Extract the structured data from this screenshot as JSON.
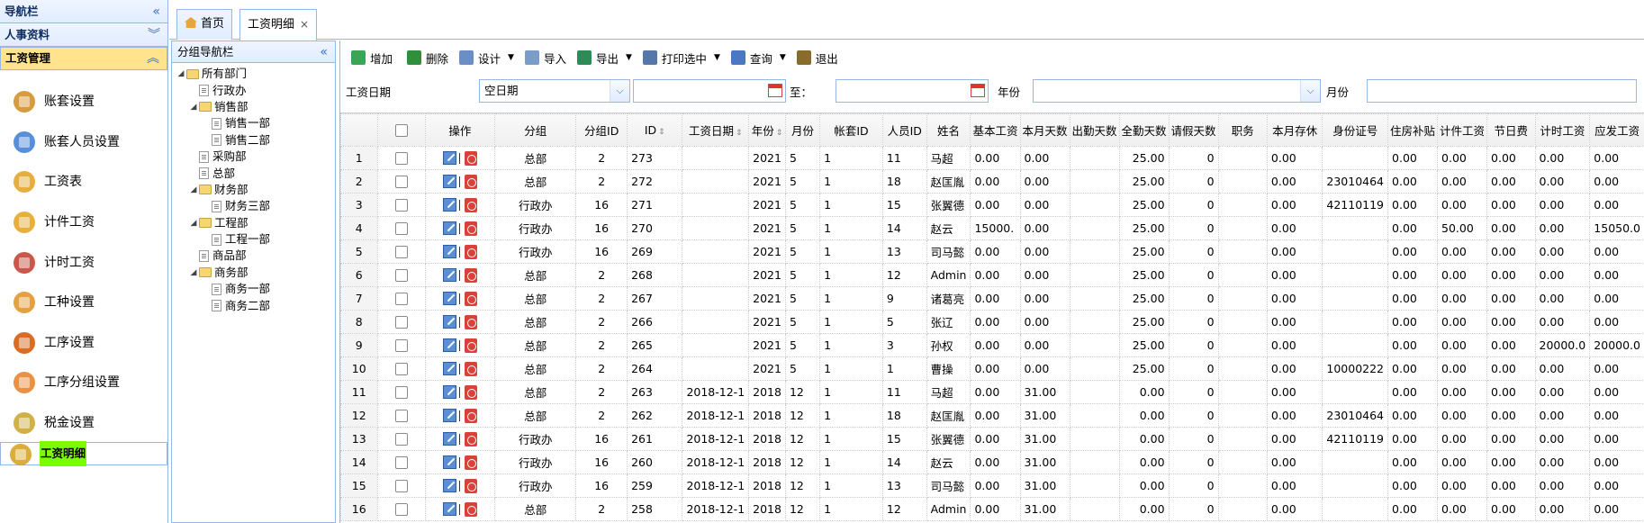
{
  "nav": {
    "sections": [
      {
        "label": "导航栏",
        "chevron": "«"
      },
      {
        "label": "人事资料",
        "chevron": "¥"
      },
      {
        "label": "工资管理",
        "chevron": "¤"
      }
    ],
    "items": [
      {
        "label": "账套设置",
        "icon": "people-settings-icon"
      },
      {
        "label": "账套人员设置",
        "icon": "people-gear-icon"
      },
      {
        "label": "工资表",
        "icon": "bar-chart-icon"
      },
      {
        "label": "计件工资",
        "icon": "coins-icon"
      },
      {
        "label": "计时工资",
        "icon": "clock-chart-icon"
      },
      {
        "label": "工种设置",
        "icon": "worker-icon"
      },
      {
        "label": "工序设置",
        "icon": "process-icon"
      },
      {
        "label": "工序分组设置",
        "icon": "process-group-icon"
      },
      {
        "label": "税金设置",
        "icon": "tax-icon"
      },
      {
        "label": "工资明细",
        "icon": "money-bag-icon"
      }
    ]
  },
  "tabs": [
    {
      "label": "首页",
      "icon": "home-icon"
    },
    {
      "label": "工资明细",
      "close": "×"
    }
  ],
  "group_panel": {
    "title": "分组导航栏",
    "chevron": "«",
    "tree": [
      {
        "label": "所有部门",
        "type": "folder",
        "level": 0
      },
      {
        "label": "行政办",
        "type": "file",
        "level": 1
      },
      {
        "label": "销售部",
        "type": "folder",
        "level": 1
      },
      {
        "label": "销售一部",
        "type": "file",
        "level": 2
      },
      {
        "label": "销售二部",
        "type": "file",
        "level": 2
      },
      {
        "label": "采购部",
        "type": "file",
        "level": 1
      },
      {
        "label": "总部",
        "type": "file",
        "level": 1
      },
      {
        "label": "财务部",
        "type": "folder",
        "level": 1
      },
      {
        "label": "财务三部",
        "type": "file",
        "level": 2
      },
      {
        "label": "工程部",
        "type": "folder",
        "level": 1
      },
      {
        "label": "工程一部",
        "type": "file",
        "level": 2
      },
      {
        "label": "商品部",
        "type": "file",
        "level": 1
      },
      {
        "label": "商务部",
        "type": "folder",
        "level": 1
      },
      {
        "label": "商务一部",
        "type": "file",
        "level": 2
      },
      {
        "label": "商务二部",
        "type": "file",
        "level": 2
      }
    ]
  },
  "toolbar": [
    {
      "label": "增加",
      "icon": "add-icon",
      "color": "#3aa655",
      "dropdown": false
    },
    {
      "label": "删除",
      "icon": "delete-icon",
      "color": "#2f8f3a",
      "dropdown": false
    },
    {
      "label": "设计",
      "icon": "design-icon",
      "color": "#6a8fc7",
      "dropdown": true
    },
    {
      "label": "导入",
      "icon": "import-icon",
      "color": "#7a9cc9",
      "dropdown": false
    },
    {
      "label": "导出",
      "icon": "excel-icon",
      "color": "#2e8b57",
      "dropdown": true
    },
    {
      "label": "打印选中",
      "icon": "print-icon",
      "color": "#5577aa",
      "dropdown": true
    },
    {
      "label": "查询",
      "icon": "search-icon",
      "color": "#4a78c2",
      "dropdown": true
    },
    {
      "label": "退出",
      "icon": "exit-icon",
      "color": "#8a6b2e",
      "dropdown": false
    }
  ],
  "filter": {
    "date_label": "工资日期",
    "date_mode": "空日期",
    "to_label": "至：",
    "year_label": "年份",
    "month_label": "月份"
  },
  "columns": [
    "操作",
    "分组",
    "分组ID",
    "ID",
    "工资日期",
    "年份",
    "月份",
    "帐套ID",
    "人员ID",
    "姓名",
    "基本工资",
    "本月天数",
    "出勤天数",
    "全勤天数",
    "请假天数",
    "职务",
    "本月存休",
    "身份证号",
    "住房补贴",
    "计件工资",
    "节日费",
    "计时工资",
    "应发工资"
  ],
  "rows": [
    [
      "1",
      "总部",
      "2",
      "273",
      "",
      "2021",
      "5",
      "1",
      "11",
      "马超",
      "0.00",
      "0.00",
      "",
      "25.00",
      "0",
      "",
      "0.00",
      "",
      "0.00",
      "0.00",
      "0.00",
      "0.00",
      "0.00"
    ],
    [
      "2",
      "总部",
      "2",
      "272",
      "",
      "2021",
      "5",
      "1",
      "18",
      "赵匡胤",
      "0.00",
      "0.00",
      "",
      "25.00",
      "0",
      "",
      "0.00",
      "23010464",
      "0.00",
      "0.00",
      "0.00",
      "0.00",
      "0.00"
    ],
    [
      "3",
      "行政办",
      "16",
      "271",
      "",
      "2021",
      "5",
      "1",
      "15",
      "张翼德",
      "0.00",
      "0.00",
      "",
      "25.00",
      "0",
      "",
      "0.00",
      "42110119",
      "0.00",
      "0.00",
      "0.00",
      "0.00",
      "0.00"
    ],
    [
      "4",
      "行政办",
      "16",
      "270",
      "",
      "2021",
      "5",
      "1",
      "14",
      "赵云",
      "15000.",
      "0.00",
      "",
      "25.00",
      "0",
      "",
      "0.00",
      "",
      "0.00",
      "50.00",
      "0.00",
      "0.00",
      "15050.0"
    ],
    [
      "5",
      "行政办",
      "16",
      "269",
      "",
      "2021",
      "5",
      "1",
      "13",
      "司马懿",
      "0.00",
      "0.00",
      "",
      "25.00",
      "0",
      "",
      "0.00",
      "",
      "0.00",
      "0.00",
      "0.00",
      "0.00",
      "0.00"
    ],
    [
      "6",
      "总部",
      "2",
      "268",
      "",
      "2021",
      "5",
      "1",
      "12",
      "Admin",
      "0.00",
      "0.00",
      "",
      "25.00",
      "0",
      "",
      "0.00",
      "",
      "0.00",
      "0.00",
      "0.00",
      "0.00",
      "0.00"
    ],
    [
      "7",
      "总部",
      "2",
      "267",
      "",
      "2021",
      "5",
      "1",
      "9",
      "诸葛亮",
      "0.00",
      "0.00",
      "",
      "25.00",
      "0",
      "",
      "0.00",
      "",
      "0.00",
      "0.00",
      "0.00",
      "0.00",
      "0.00"
    ],
    [
      "8",
      "总部",
      "2",
      "266",
      "",
      "2021",
      "5",
      "1",
      "5",
      "张辽",
      "0.00",
      "0.00",
      "",
      "25.00",
      "0",
      "",
      "0.00",
      "",
      "0.00",
      "0.00",
      "0.00",
      "0.00",
      "0.00"
    ],
    [
      "9",
      "总部",
      "2",
      "265",
      "",
      "2021",
      "5",
      "1",
      "3",
      "孙权",
      "0.00",
      "0.00",
      "",
      "25.00",
      "0",
      "",
      "0.00",
      "",
      "0.00",
      "0.00",
      "0.00",
      "20000.0",
      "20000.0"
    ],
    [
      "10",
      "总部",
      "2",
      "264",
      "",
      "2021",
      "5",
      "1",
      "1",
      "曹操",
      "0.00",
      "0.00",
      "",
      "25.00",
      "0",
      "",
      "0.00",
      "10000222",
      "0.00",
      "0.00",
      "0.00",
      "0.00",
      "0.00"
    ],
    [
      "11",
      "总部",
      "2",
      "263",
      "2018-12-1",
      "2018",
      "12",
      "1",
      "11",
      "马超",
      "0.00",
      "31.00",
      "",
      "0.00",
      "0",
      "",
      "0.00",
      "",
      "0.00",
      "0.00",
      "0.00",
      "0.00",
      "0.00"
    ],
    [
      "12",
      "总部",
      "2",
      "262",
      "2018-12-1",
      "2018",
      "12",
      "1",
      "18",
      "赵匡胤",
      "0.00",
      "31.00",
      "",
      "0.00",
      "0",
      "",
      "0.00",
      "23010464",
      "0.00",
      "0.00",
      "0.00",
      "0.00",
      "0.00"
    ],
    [
      "13",
      "行政办",
      "16",
      "261",
      "2018-12-1",
      "2018",
      "12",
      "1",
      "15",
      "张翼德",
      "0.00",
      "31.00",
      "",
      "0.00",
      "0",
      "",
      "0.00",
      "42110119",
      "0.00",
      "0.00",
      "0.00",
      "0.00",
      "0.00"
    ],
    [
      "14",
      "行政办",
      "16",
      "260",
      "2018-12-1",
      "2018",
      "12",
      "1",
      "14",
      "赵云",
      "0.00",
      "31.00",
      "",
      "0.00",
      "0",
      "",
      "0.00",
      "",
      "0.00",
      "0.00",
      "0.00",
      "0.00",
      "0.00"
    ],
    [
      "15",
      "行政办",
      "16",
      "259",
      "2018-12-1",
      "2018",
      "12",
      "1",
      "13",
      "司马懿",
      "0.00",
      "31.00",
      "",
      "0.00",
      "0",
      "",
      "0.00",
      "",
      "0.00",
      "0.00",
      "0.00",
      "0.00",
      "0.00"
    ],
    [
      "16",
      "总部",
      "2",
      "258",
      "2018-12-1",
      "2018",
      "12",
      "1",
      "12",
      "Admin",
      "0.00",
      "31.00",
      "",
      "0.00",
      "0",
      "",
      "0.00",
      "",
      "0.00",
      "0.00",
      "0.00",
      "0.00",
      "0.00"
    ]
  ]
}
